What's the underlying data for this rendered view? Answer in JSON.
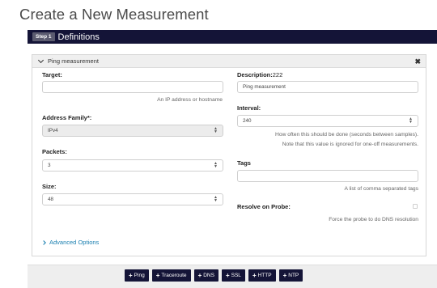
{
  "page": {
    "title": "Create a New Measurement"
  },
  "step": {
    "badge": "Step 1",
    "title": "Definitions"
  },
  "panel": {
    "title": "Ping measurement",
    "close_icon": "close-x-icon"
  },
  "form": {
    "target": {
      "label": "Target:",
      "value": "",
      "help": "An IP address or hostname"
    },
    "address_family": {
      "label": "Address Family*:",
      "value": "IPv4"
    },
    "packets": {
      "label": "Packets:",
      "value": "3"
    },
    "size": {
      "label": "Size:",
      "value": "48"
    },
    "description": {
      "label": "Description:",
      "counter": "222",
      "value": "Ping measurement"
    },
    "interval": {
      "label": "Interval:",
      "value": "240",
      "help1": "How often this should be done (seconds between samples).",
      "help2": "Note that this value is ignored for one-off measurements."
    },
    "tags": {
      "label": "Tags",
      "value": "",
      "help": "A list of comma separated tags"
    },
    "resolve": {
      "label": "Resolve on Probe:",
      "checked": false,
      "help": "Force the probe to do DNS resolution"
    }
  },
  "advanced": {
    "label": "Advanced Options"
  },
  "toolbar": {
    "buttons": [
      {
        "label": "Ping"
      },
      {
        "label": "Traceroute"
      },
      {
        "label": "DNS"
      },
      {
        "label": "SSL"
      },
      {
        "label": "HTTP"
      },
      {
        "label": "NTP"
      }
    ]
  },
  "colors": {
    "accent": "#141437",
    "link": "#1a7fb0"
  }
}
